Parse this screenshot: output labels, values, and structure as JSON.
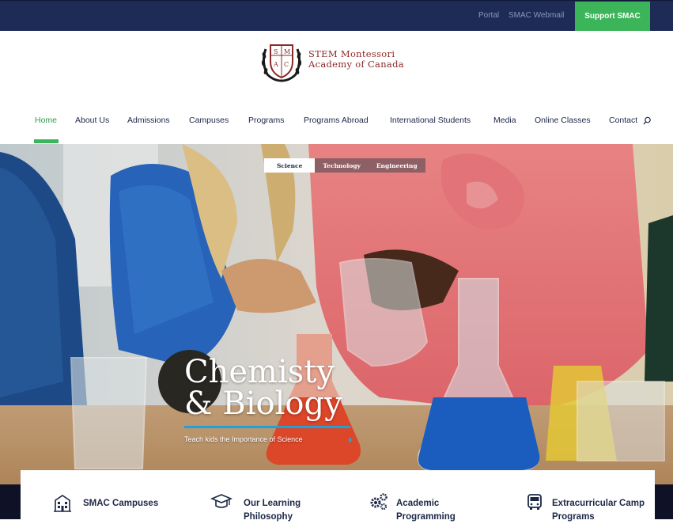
{
  "topbar": {
    "portal_label": "Portal",
    "webmail_label": "SMAC Webmail",
    "support_label": "Support SMAC"
  },
  "logo": {
    "crest_letters": "SMAC",
    "line1": "STEM Montessori",
    "line2": "Academy of Canada"
  },
  "nav": {
    "items": [
      {
        "label": "Home"
      },
      {
        "label": "About Us"
      },
      {
        "label": "Admissions"
      },
      {
        "label": "Campuses"
      },
      {
        "label": "Programs"
      },
      {
        "label": "Programs Abroad"
      },
      {
        "label": "International Students"
      },
      {
        "label": "Media"
      },
      {
        "label": "Online Classes"
      },
      {
        "label": "Contact"
      }
    ],
    "active": "Home"
  },
  "hero": {
    "tabs": [
      "Science",
      "Technology",
      "Engineering"
    ],
    "active_tab": "Science",
    "title_line1": "Chemisty",
    "title_line2": "& Biology",
    "subtitle": "Teach kids the Importance of Science"
  },
  "features": [
    {
      "icon": "building-icon",
      "label_line1": "SMAC Campuses",
      "label_line2": ""
    },
    {
      "icon": "graduation-cap-icon",
      "label_line1": "Our Learning",
      "label_line2": "Philosophy"
    },
    {
      "icon": "gears-icon",
      "label_line1": "Academic",
      "label_line2": "Programming"
    },
    {
      "icon": "bus-icon",
      "label_line1": "Extracurricular Camp",
      "label_line2": "Programs"
    }
  ],
  "colors": {
    "topbar_bg": "#1d2b56",
    "accent_green": "#3cb55a",
    "nav_text": "#1b2747",
    "logo_red": "#8c2a2a",
    "hero_accent_blue": "#1fa0d8"
  }
}
